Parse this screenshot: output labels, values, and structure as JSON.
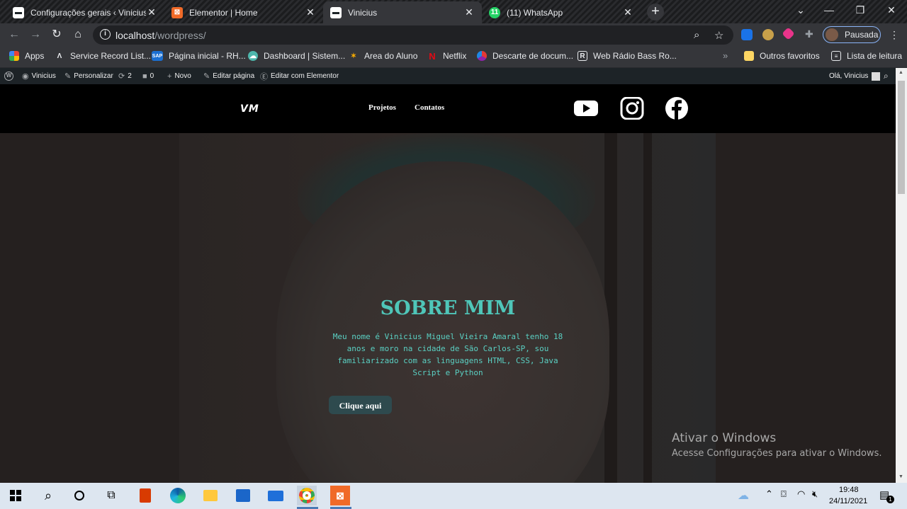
{
  "tabs": [
    {
      "title": "Configurações gerais ‹ Vinicius —",
      "active": false
    },
    {
      "title": "Elementor | Home",
      "active": false
    },
    {
      "title": "Vinicius",
      "active": true
    },
    {
      "title": "(11) WhatsApp",
      "active": false
    }
  ],
  "toolbar": {
    "url_host": "localhost",
    "url_path": "/wordpress/",
    "profile_label": "Pausada"
  },
  "bookmarks": [
    {
      "label": "Apps",
      "icon": "apps-grid-icon"
    },
    {
      "label": "Service Record List...",
      "icon": "arrow-logo-icon"
    },
    {
      "label": "Página inicial - RH...",
      "icon": "sap-icon"
    },
    {
      "label": "Dashboard | Sistem...",
      "icon": "cloud-icon"
    },
    {
      "label": "Area do Aluno",
      "icon": "star-person-icon"
    },
    {
      "label": "Netflix",
      "icon": "netflix-icon"
    },
    {
      "label": "Descarte de docum...",
      "icon": "pie-icon"
    },
    {
      "label": "Web Rádio Bass Ro...",
      "icon": "r-icon"
    },
    {
      "label": "Outros favoritos",
      "icon": "folder-icon"
    },
    {
      "label": "Lista de leitura",
      "icon": "reading-list-icon"
    }
  ],
  "wp_admin_bar": {
    "site_name": "Vinicius",
    "customize": "Personalizar",
    "updates": "2",
    "comments": "0",
    "new": "Novo",
    "edit_page": "Editar página",
    "edit_elementor": "Editar com Elementor",
    "greeting": "Olá, Vinicius"
  },
  "site": {
    "logo": "VM",
    "nav": [
      "Projetos",
      "Contatos"
    ],
    "social": [
      "youtube-icon",
      "instagram-icon",
      "facebook-icon"
    ]
  },
  "hero": {
    "title": "SOBRE MIM",
    "text": "Meu nome é Vinicius Miguel Vieira Amaral tenho 18 anos e moro na cidade de São Carlos-SP, sou familiarizado com as linguagens HTML, CSS, Java Script e Python",
    "button": "Clique aqui",
    "title_color": "#4fc6b9"
  },
  "watermark": {
    "line1": "Ativar o Windows",
    "line2": "Acesse Configurações para ativar o Windows."
  },
  "taskbar": {
    "time": "19:48",
    "date": "24/11/2021",
    "notifications": "1"
  }
}
